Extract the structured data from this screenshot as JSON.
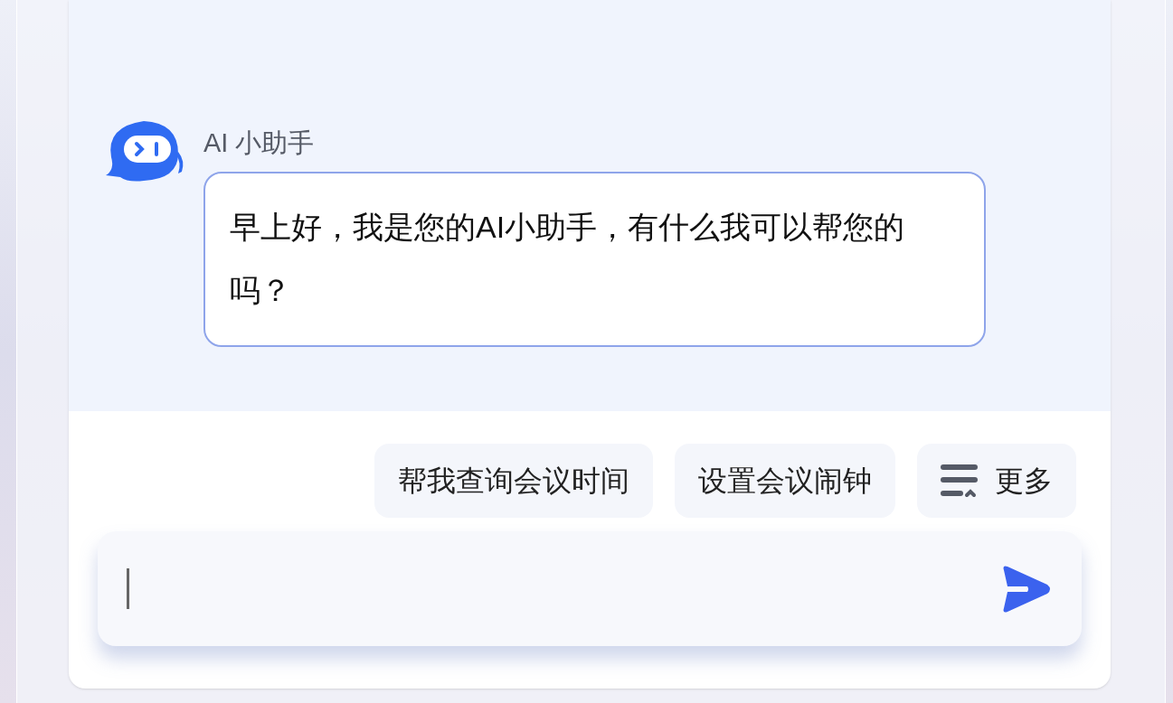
{
  "assistant": {
    "name": "AI 小助手",
    "message": "早上好，我是您的AI小助手，有什么我可以帮您的吗？"
  },
  "suggestions": [
    {
      "kind": "query",
      "label": "帮我查询会议时间"
    },
    {
      "kind": "query",
      "label": "设置会议闹钟"
    },
    {
      "kind": "more",
      "label": "更多"
    }
  ]
}
